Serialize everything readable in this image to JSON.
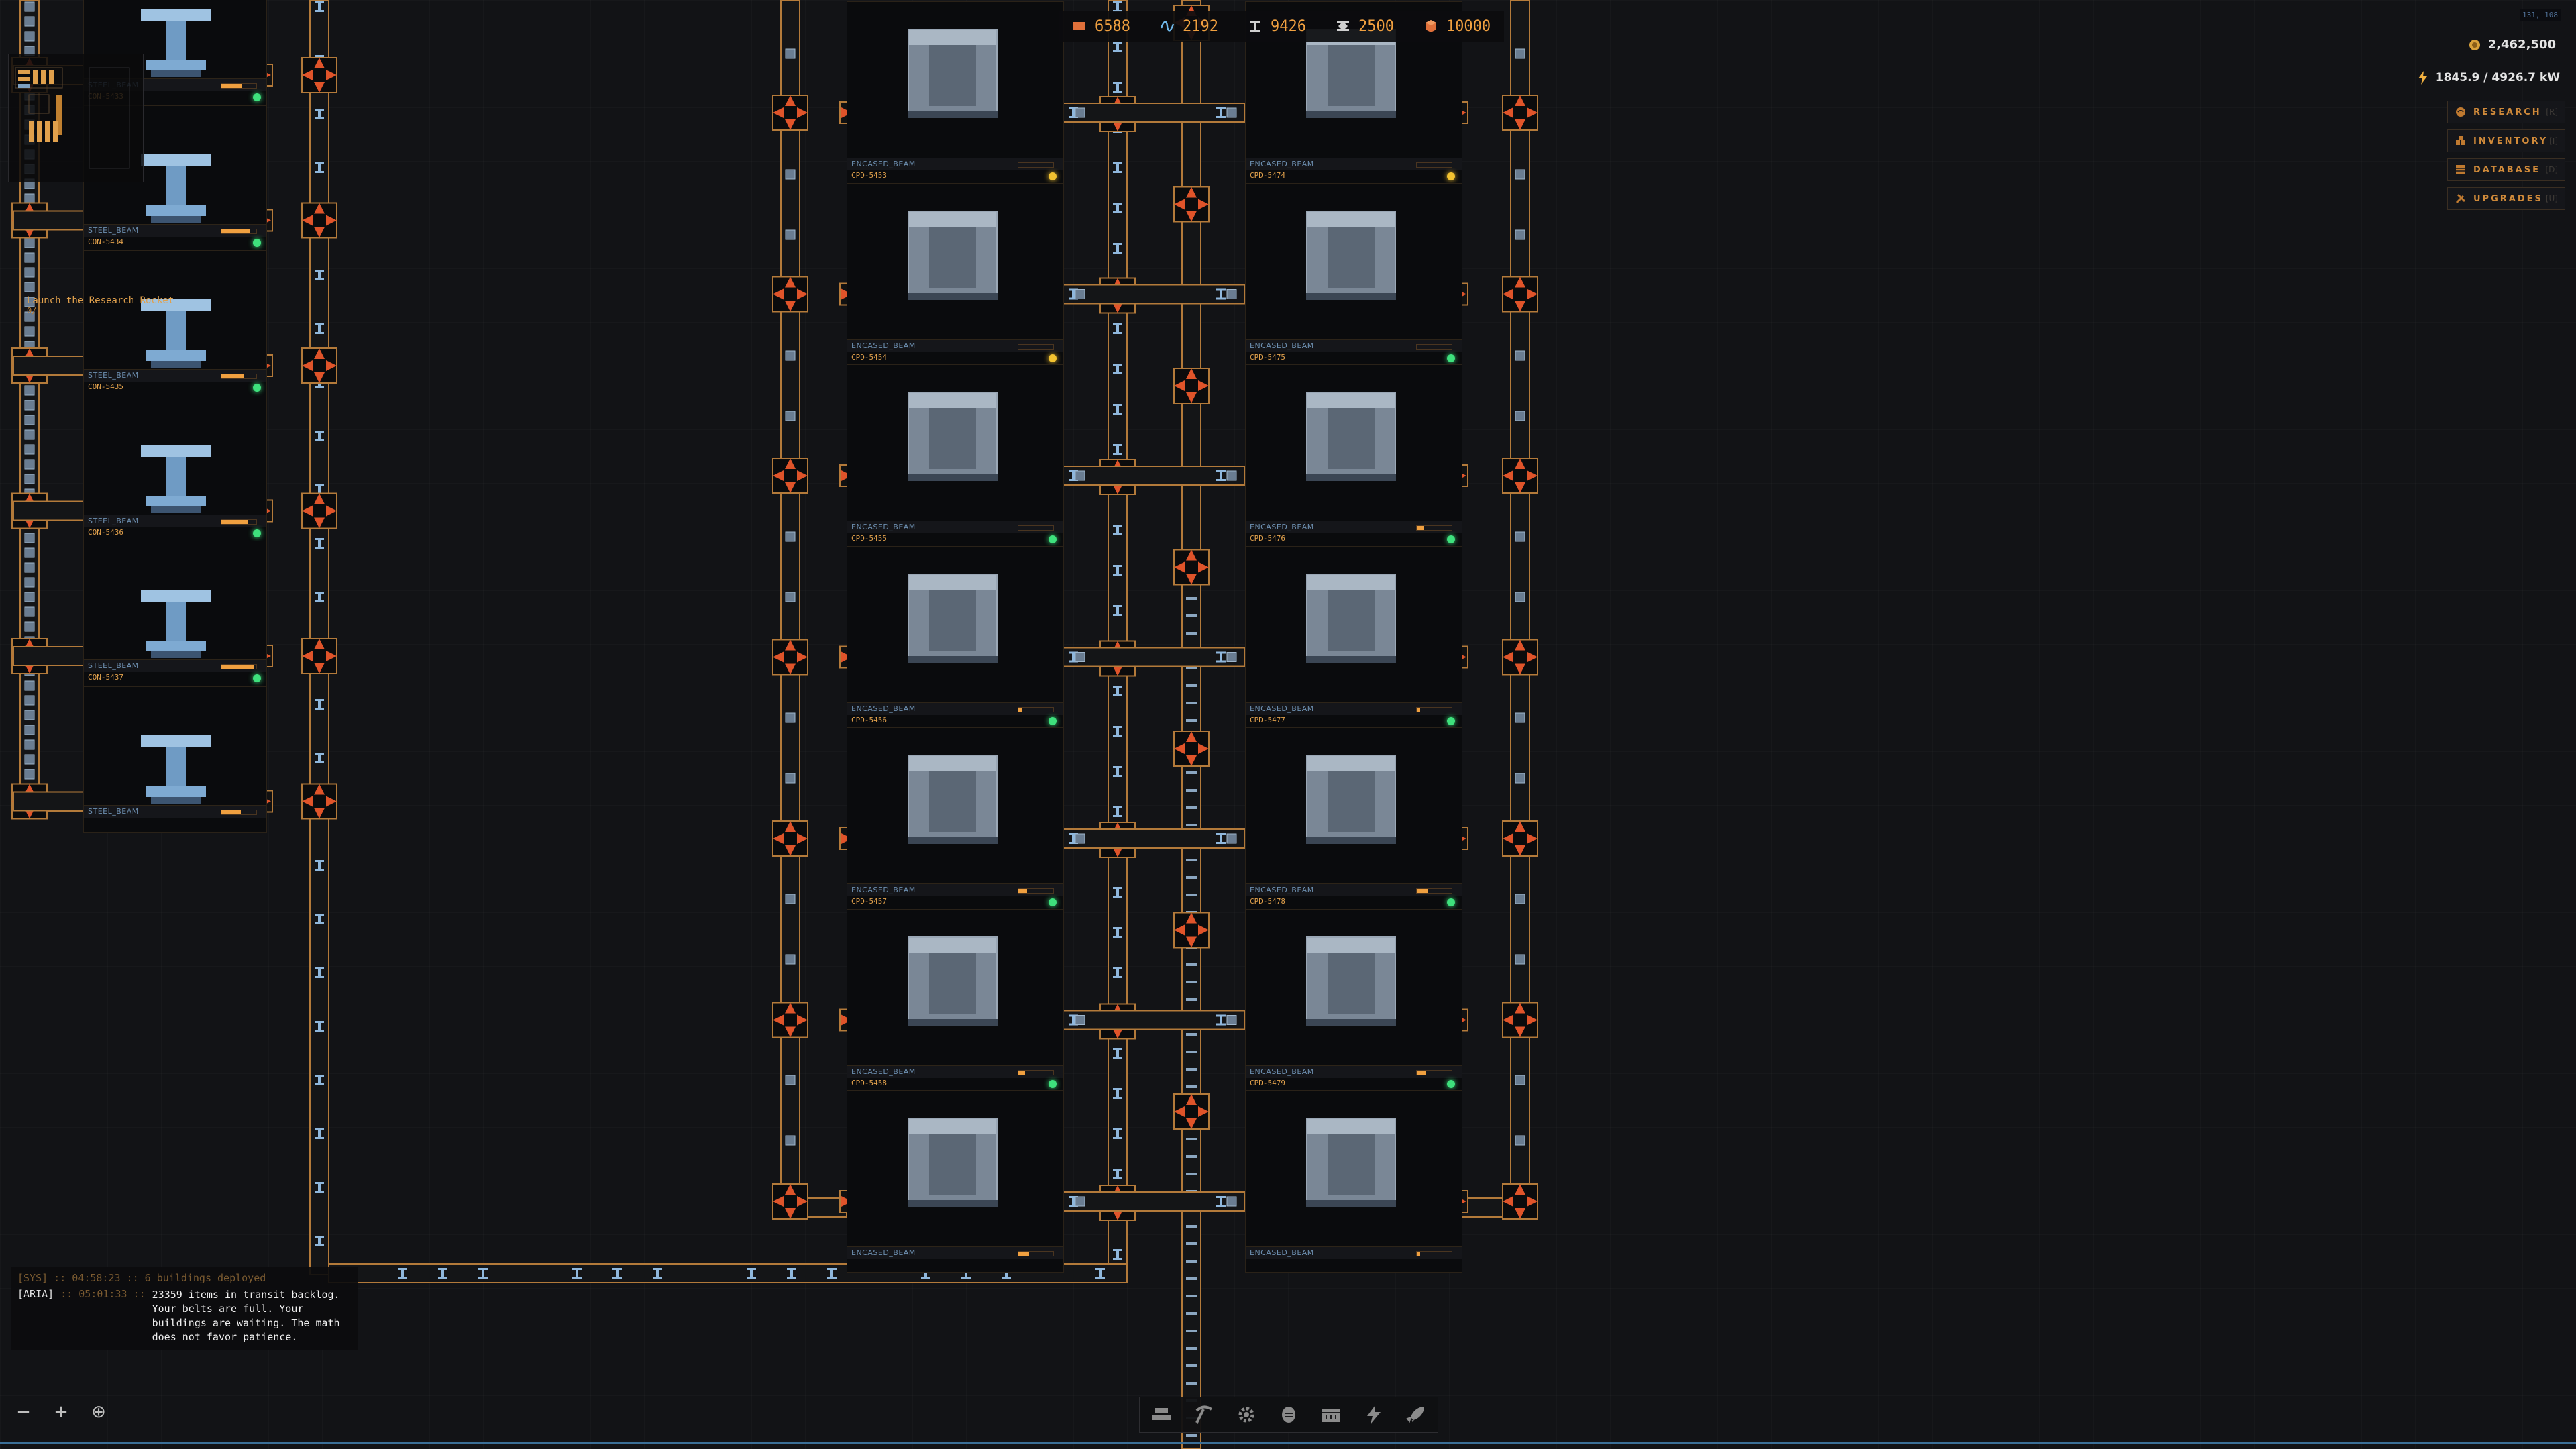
{
  "resources": [
    {
      "name": "iron-plate",
      "value": "6588",
      "color": "#e0703a"
    },
    {
      "name": "wire",
      "value": "2192",
      "color": "#6fb7e8"
    },
    {
      "name": "steel-beam",
      "value": "9426",
      "color": "#cfcfcf"
    },
    {
      "name": "encased-beam",
      "value": "2500",
      "color": "#cfcfcf"
    },
    {
      "name": "cube",
      "value": "10000",
      "color": "#e0703a"
    }
  ],
  "coords": "131, 108",
  "credits": "2,462,500",
  "power": "1845.9 / 4926.7 kW",
  "menu": [
    {
      "label": "RESEARCH",
      "key": "[R]"
    },
    {
      "label": "INVENTORY",
      "key": "[I]"
    },
    {
      "label": "DATABASE",
      "key": "[D]"
    },
    {
      "label": "UPGRADES",
      "key": "[U]"
    }
  ],
  "objective": {
    "title": "Launch the Research Rocket",
    "sub": "0/1"
  },
  "left_machines": [
    {
      "id": "CON-5433",
      "product": "STEEL_BEAM",
      "progress": 0.6
    },
    {
      "id": "CON-5434",
      "product": "STEEL_BEAM",
      "progress": 0.8
    },
    {
      "id": "CON-5435",
      "product": "STEEL_BEAM",
      "progress": 0.65
    },
    {
      "id": "CON-5436",
      "product": "STEEL_BEAM",
      "progress": 0.75
    },
    {
      "id": "CON-5437",
      "product": "STEEL_BEAM",
      "progress": 0.95
    },
    {
      "id": "",
      "product": "STEEL_BEAM",
      "progress": 0.55
    }
  ],
  "center_machines": [
    {
      "id": "CPD-5453",
      "product": "ENCASED_BEAM",
      "progress": 0.0,
      "status": "yellow"
    },
    {
      "id": "CPD-5454",
      "product": "ENCASED_BEAM",
      "progress": 0.0,
      "status": "yellow"
    },
    {
      "id": "CPD-5455",
      "product": "ENCASED_BEAM",
      "progress": 0.0,
      "status": "green"
    },
    {
      "id": "CPD-5456",
      "product": "ENCASED_BEAM",
      "progress": 0.12,
      "status": "green"
    },
    {
      "id": "CPD-5457",
      "product": "ENCASED_BEAM",
      "progress": 0.25,
      "status": "green"
    },
    {
      "id": "CPD-5458",
      "product": "ENCASED_BEAM",
      "progress": 0.2,
      "status": "green"
    },
    {
      "id": "",
      "product": "ENCASED_BEAM",
      "progress": 0.3,
      "status": ""
    }
  ],
  "right_machines": [
    {
      "id": "CPD-5474",
      "product": "ENCASED_BEAM",
      "progress": 0.0,
      "status": "yellow"
    },
    {
      "id": "CPD-5475",
      "product": "ENCASED_BEAM",
      "progress": 0.0,
      "status": "green"
    },
    {
      "id": "CPD-5476",
      "product": "ENCASED_BEAM",
      "progress": 0.2,
      "status": "green"
    },
    {
      "id": "CPD-5477",
      "product": "ENCASED_BEAM",
      "progress": 0.1,
      "status": "green"
    },
    {
      "id": "CPD-5478",
      "product": "ENCASED_BEAM",
      "progress": 0.3,
      "status": "green"
    },
    {
      "id": "CPD-5479",
      "product": "ENCASED_BEAM",
      "progress": 0.25,
      "status": "green"
    },
    {
      "id": "",
      "product": "ENCASED_BEAM",
      "progress": 0.1,
      "status": ""
    }
  ],
  "log": {
    "line1": "[SYS] :: 04:58:23 :: 6 buildings deployed",
    "tag": "[ARIA]",
    "time": ":: 05:01:33 ::",
    "message": "23359 items in transit backlog. Your belts are full. Your buildings are waiting. The math does not favor patience."
  },
  "zoom": {
    "out": "−",
    "in": "+",
    "center": "⊕"
  },
  "toolbar": [
    "conveyor-icon",
    "pickaxe-icon",
    "gear-icon",
    "research-icon",
    "storage-icon",
    "power-icon",
    "rocket-icon"
  ]
}
